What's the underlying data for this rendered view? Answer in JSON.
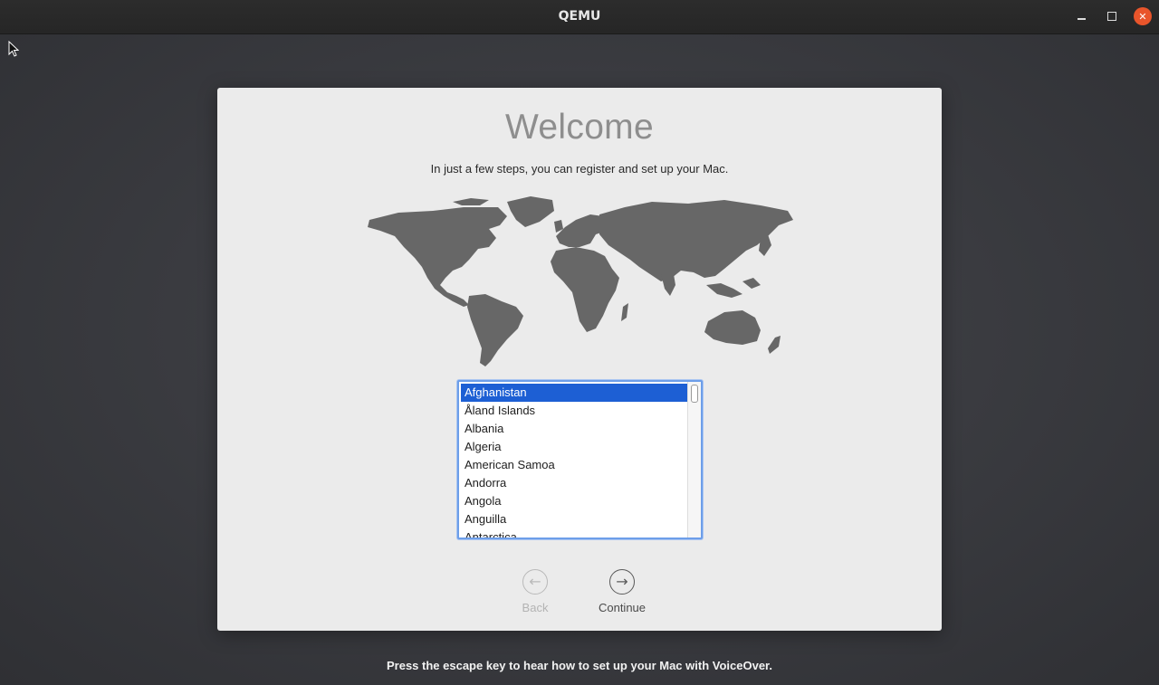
{
  "window": {
    "title": "QEMU",
    "controls": {
      "minimize_icon": "minimize-icon",
      "maximize_icon": "maximize-icon",
      "close_icon": "close-icon",
      "close_color": "#e9552b"
    }
  },
  "setup": {
    "heading": "Welcome",
    "subtitle": "In just a few steps, you can register and set up your Mac.",
    "map_icon": "world-map",
    "country_list": {
      "selected": "Afghanistan",
      "items": [
        "Afghanistan",
        "Åland Islands",
        "Albania",
        "Algeria",
        "American Samoa",
        "Andorra",
        "Angola",
        "Anguilla",
        "Antarctica"
      ]
    },
    "nav": {
      "back_label": "Back",
      "back_icon": "arrow-left-icon",
      "continue_label": "Continue",
      "continue_icon": "arrow-right-icon"
    }
  },
  "footer": "Press the escape key to hear how to set up your Mac with VoiceOver.",
  "colors": {
    "selection": "#1d5fd4",
    "dialog_bg": "#ebebeb"
  }
}
